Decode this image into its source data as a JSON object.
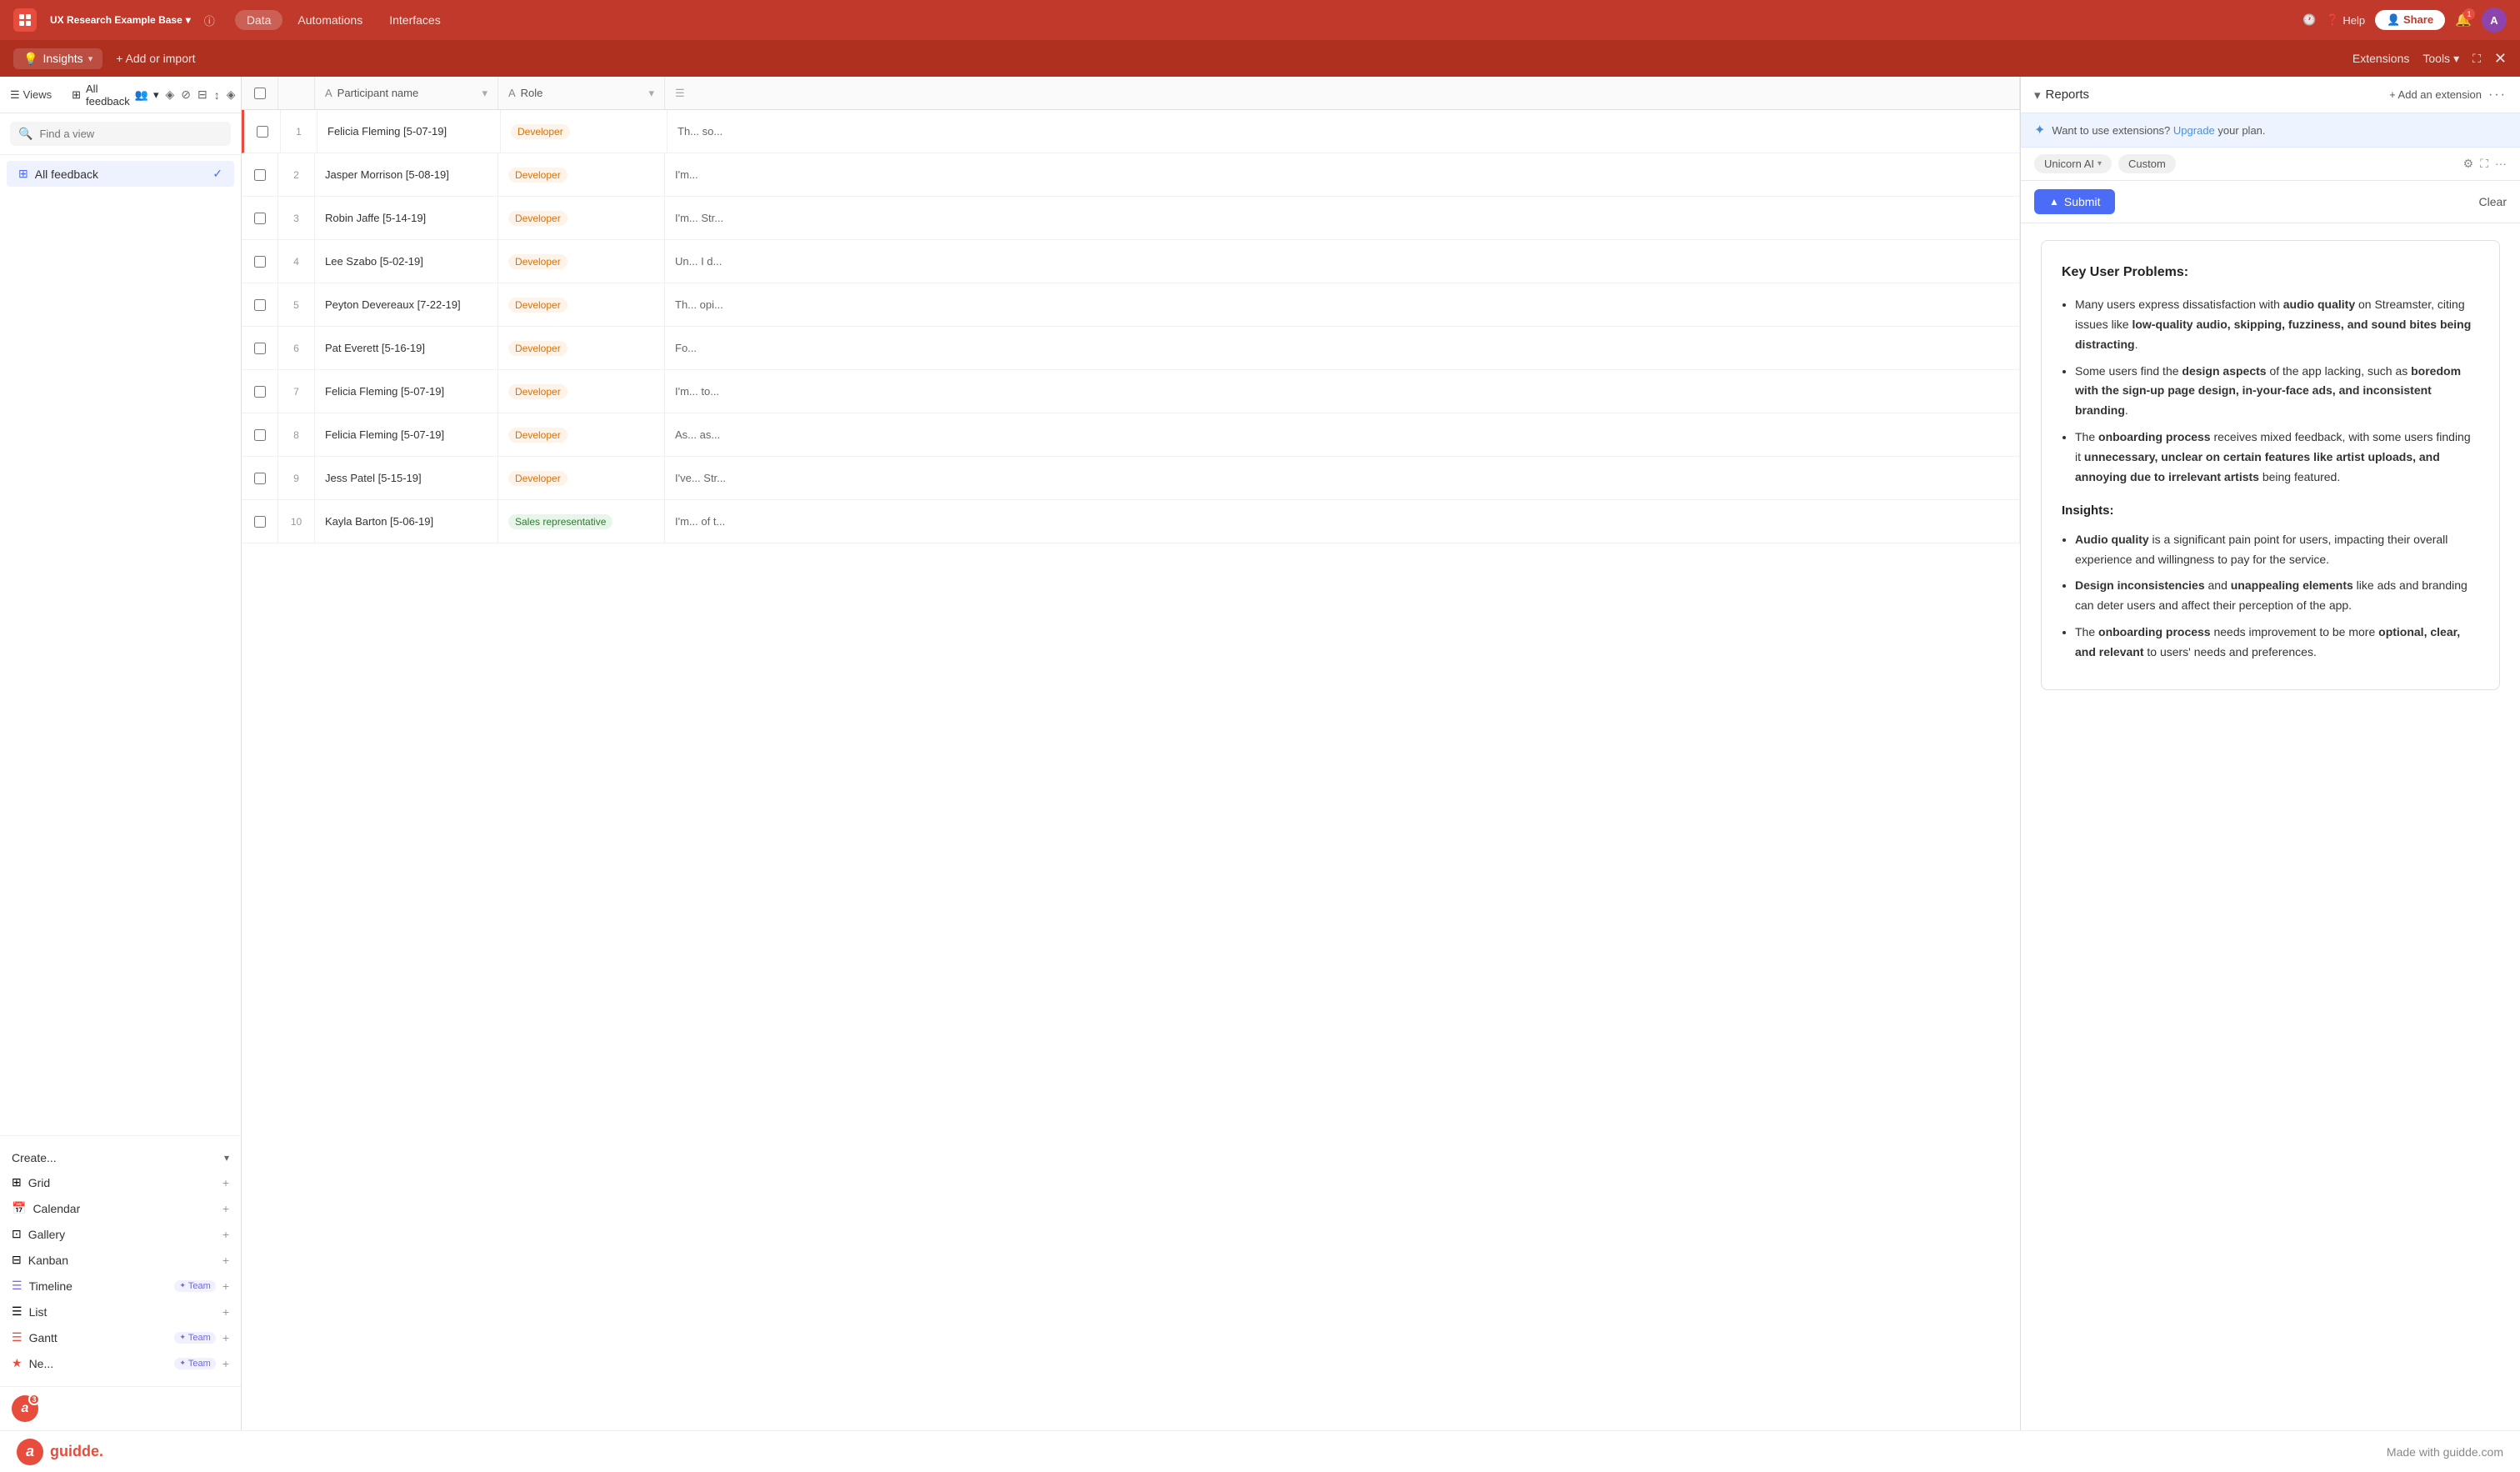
{
  "app": {
    "name": "UX Research Example Base",
    "nav_tabs": [
      "Data",
      "Automations",
      "Interfaces"
    ],
    "active_tab": "Data",
    "help": "Help",
    "share": "Share",
    "avatar_initials": "A",
    "notif_count": "1"
  },
  "insights_bar": {
    "insights_label": "Insights",
    "dropdown_icon": "▾",
    "add_import": "+ Add or import",
    "extensions": "Extensions",
    "tools": "Tools",
    "tools_arrow": "▾"
  },
  "toolbar": {
    "views_label": "Views",
    "all_feedback": "All feedback",
    "filter_icon": "⊘",
    "sort_icon": "↕",
    "group_icon": "⊟",
    "field_icon": "◈",
    "expand_icon": "⛶",
    "search_icon": "🔍"
  },
  "sidebar": {
    "search_placeholder": "Find a view",
    "views": [
      {
        "id": "all-feedback",
        "label": "All feedback",
        "icon": "⊞",
        "active": true
      }
    ],
    "create_label": "Create...",
    "create_items": [
      {
        "id": "grid",
        "label": "Grid",
        "icon": "⊞",
        "badge": null
      },
      {
        "id": "calendar",
        "label": "Calendar",
        "icon": "📅",
        "badge": null
      },
      {
        "id": "gallery",
        "label": "Gallery",
        "icon": "⊡",
        "badge": null
      },
      {
        "id": "kanban",
        "label": "Kanban",
        "icon": "⊟",
        "badge": null
      },
      {
        "id": "timeline",
        "label": "Timeline",
        "icon": "☰",
        "badge": "Team"
      },
      {
        "id": "list",
        "label": "List",
        "icon": "☰",
        "badge": null
      },
      {
        "id": "gantt",
        "label": "Gantt",
        "icon": "☰",
        "badge": "Team"
      },
      {
        "id": "new",
        "label": "Ne...",
        "icon": "★",
        "badge": "Team"
      }
    ],
    "logo_initial": "a",
    "logo_count": "3"
  },
  "table": {
    "columns": [
      {
        "id": "check",
        "label": ""
      },
      {
        "id": "num",
        "label": ""
      },
      {
        "id": "participant",
        "label": "Participant name"
      },
      {
        "id": "role",
        "label": "Role"
      },
      {
        "id": "notes",
        "label": ""
      }
    ],
    "rows": [
      {
        "num": 1,
        "name": "Felicia Fleming [5-07-19]",
        "role": "Developer",
        "notes": "Th... so..."
      },
      {
        "num": 2,
        "name": "Jasper Morrison [5-08-19]",
        "role": "Developer",
        "notes": "I'm..."
      },
      {
        "num": 3,
        "name": "Robin Jaffe [5-14-19]",
        "role": "Developer",
        "notes": "I'm... Str..."
      },
      {
        "num": 4,
        "name": "Lee Szabo [5-02-19]",
        "role": "Developer",
        "notes": "Un... I d..."
      },
      {
        "num": 5,
        "name": "Peyton Devereaux [7-22-19]",
        "role": "Developer",
        "notes": "Th... opi..."
      },
      {
        "num": 6,
        "name": "Pat Everett [5-16-19]",
        "role": "Developer",
        "notes": "Fo..."
      },
      {
        "num": 7,
        "name": "Felicia Fleming [5-07-19]",
        "role": "Developer",
        "notes": "I'm... to..."
      },
      {
        "num": 8,
        "name": "Felicia Fleming [5-07-19]",
        "role": "Developer",
        "notes": "As... as..."
      },
      {
        "num": 9,
        "name": "Jess Patel [5-15-19]",
        "role": "Developer",
        "notes": "I've... Str..."
      },
      {
        "num": 10,
        "name": "Kayla Barton [5-06-19]",
        "role": "Sales representative",
        "notes": "I'm... of t..."
      }
    ]
  },
  "right_panel": {
    "reports_label": "Reports",
    "reports_arrow": "▾",
    "add_extension": "+ Add an extension",
    "more_icon": "···",
    "upgrade_text": "Want to use extensions?",
    "upgrade_link": "Upgrade",
    "upgrade_suffix": "your plan.",
    "ai_tab": "Unicorn AI",
    "custom_tab": "Custom",
    "submit_btn": "Submit",
    "clear_btn": "Clear",
    "ai_content": {
      "title": "Key User Problems:",
      "problems": [
        {
          "text_before": "Many users express dissatisfaction with ",
          "bold1": "audio quality",
          "text_mid": " on Streamster, citing issues like ",
          "bold2": "low-quality audio, skipping, fuzziness, and sound bites being distracting",
          "text_after": "."
        },
        {
          "text_before": "Some users find the ",
          "bold1": "design aspects",
          "text_mid": " of the app lacking, such as ",
          "bold2": "boredom with the sign-up page design, in-your-face ads, and inconsistent branding",
          "text_after": "."
        },
        {
          "text_before": "The ",
          "bold1": "onboarding process",
          "text_mid": " receives mixed feedback, with some users finding it ",
          "bold2": "unnecessary, unclear on certain features like artist uploads, and annoying due to irrelevant artists",
          "text_after": " being featured."
        }
      ],
      "insights_title": "Insights:",
      "insights": [
        {
          "bold": "Audio quality",
          "text": " is a significant pain point for users, impacting their overall experience and willingness to pay for the service."
        },
        {
          "bold": "Design inconsistencies",
          "text": " and ",
          "bold2": "unappealing elements",
          "text2": " like ads and branding can deter users and affect their perception of the app."
        },
        {
          "text_before": "The ",
          "bold": "onboarding process",
          "text": " needs improvement to be more ",
          "bold2": "optional, clear, and relevant",
          "text2": " to users' needs and preferences."
        }
      ]
    }
  },
  "guidde": {
    "logo_letter": "a",
    "brand_name": "guidde.",
    "watermark": "Made with guidde.com"
  }
}
